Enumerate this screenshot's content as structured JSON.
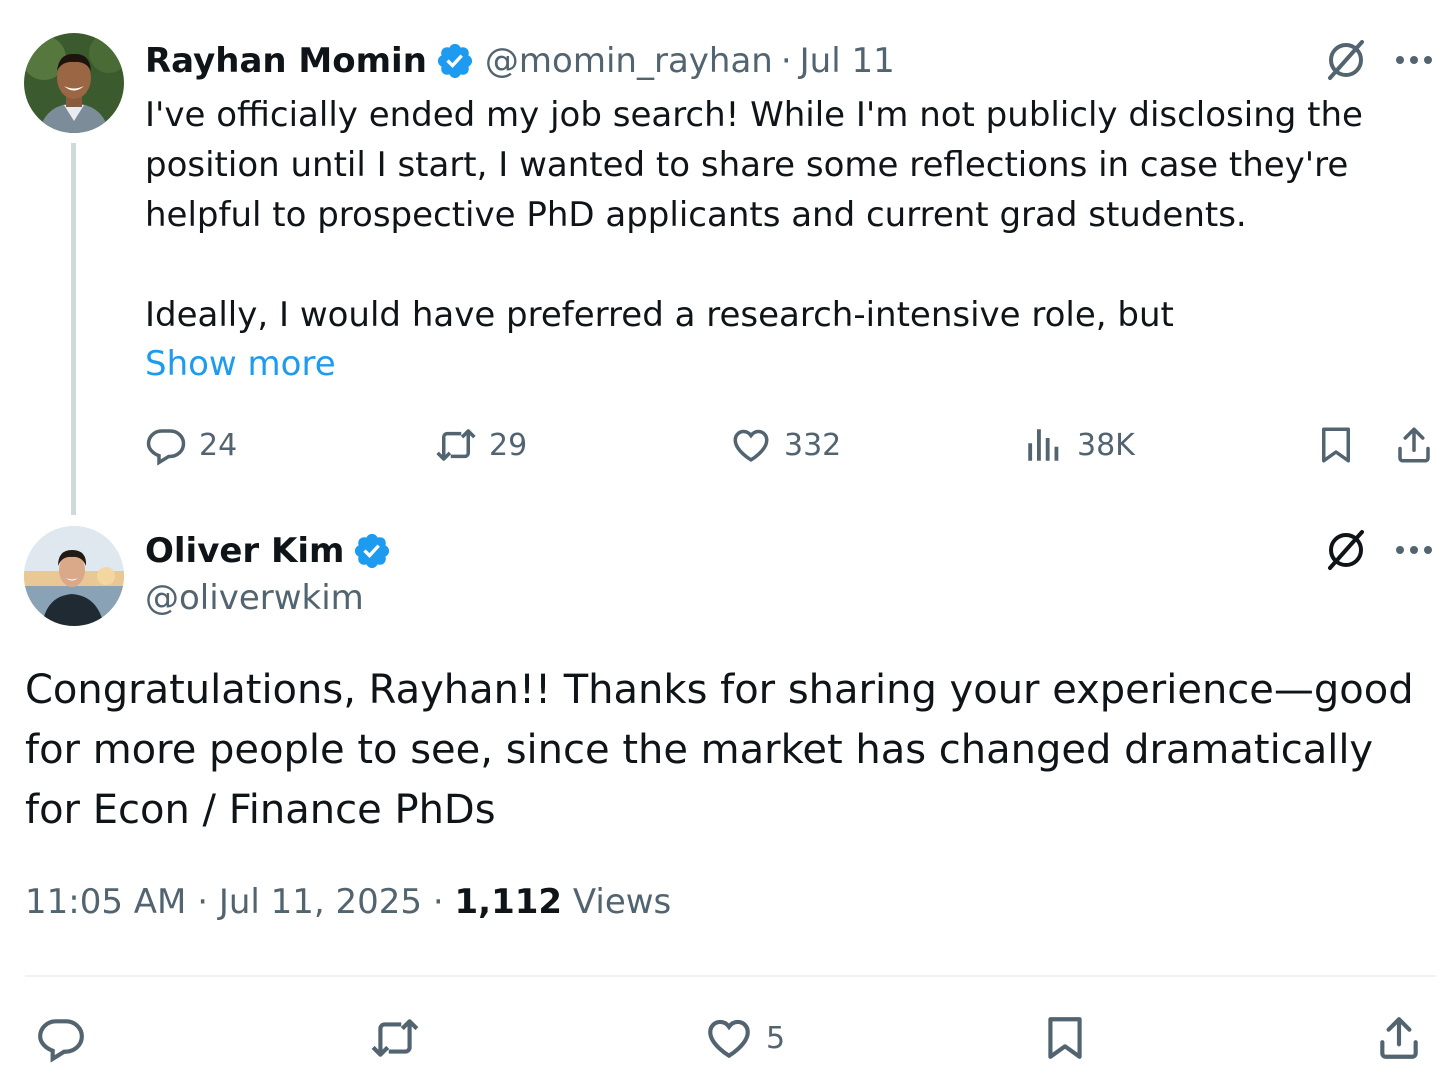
{
  "parent_tweet": {
    "author_name": "Rayhan Momin",
    "handle": "@momin_rayhan",
    "separator": "·",
    "date": "Jul 11",
    "body": "I've officially ended my job search! While I'm not publicly disclosing the position until I start, I wanted to share some reflections in case they're helpful to prospective PhD applicants and current grad students.\n\nIdeally, I would have preferred a research-intensive role, but",
    "show_more": "Show more",
    "replies": "24",
    "reposts": "29",
    "likes": "332",
    "views": "38K",
    "verified": true
  },
  "reply_tweet": {
    "author_name": "Oliver Kim",
    "handle": "@oliverwkim",
    "body": "Congratulations, Rayhan!! Thanks for sharing your experience—good for more people to see, since the market has changed dramatically for Econ / Finance PhDs",
    "time": "11:05 AM",
    "separator": "·",
    "date": "Jul 11, 2025",
    "views_count": "1,112",
    "views_label": "Views",
    "likes": "5",
    "verified": true
  },
  "colors": {
    "text_primary": "#0f1419",
    "text_secondary": "#536471",
    "link": "#1d9bf0",
    "verified_badge": "#1d9bf0",
    "thread_line": "#cfd9de",
    "divider": "#eff3f4"
  },
  "icons": [
    "verified-badge-icon",
    "grok-icon",
    "more-icon",
    "reply-icon",
    "repost-icon",
    "like-icon",
    "views-icon",
    "bookmark-icon",
    "share-icon"
  ]
}
